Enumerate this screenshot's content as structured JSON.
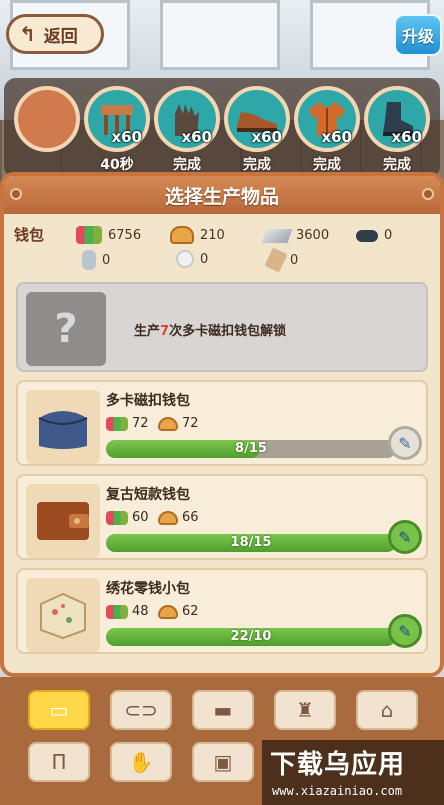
{
  "top": {
    "back_label": "返回",
    "upgrade_label": "升级"
  },
  "queue": [
    {
      "icon": "empty-slot",
      "qty": "",
      "status": ""
    },
    {
      "icon": "stool-icon",
      "qty": "x60",
      "status": "40秒"
    },
    {
      "icon": "gloves-icon",
      "qty": "x60",
      "status": "完成"
    },
    {
      "icon": "shoe-icon",
      "qty": "x60",
      "status": "完成"
    },
    {
      "icon": "jacket-icon",
      "qty": "x60",
      "status": "完成"
    },
    {
      "icon": "boot-icon",
      "qty": "x60",
      "status": "完成"
    }
  ],
  "panel": {
    "title": "选择生产物品",
    "wallet_label": "钱包"
  },
  "resources": [
    {
      "icon": "fabric-icon",
      "value": "6756"
    },
    {
      "icon": "cotton-icon",
      "value": "210"
    },
    {
      "icon": "metal-icon",
      "value": "3600"
    },
    {
      "icon": "dark-material-icon",
      "value": "0"
    },
    {
      "icon": "thread-icon",
      "value": "0"
    },
    {
      "icon": "ball-icon",
      "value": "0"
    },
    {
      "icon": "wood-icon",
      "value": "0"
    }
  ],
  "locked_item": {
    "prefix": "生产",
    "count": "7",
    "suffix": "次多卡磁扣钱包解锁",
    "thumb": "?"
  },
  "items": [
    {
      "name": "多卡磁扣钱包",
      "cost1": "72",
      "cost2": "72",
      "progress_text": "8/15",
      "progress": 0.53,
      "ready": false
    },
    {
      "name": "复古短款钱包",
      "cost1": "60",
      "cost2": "66",
      "progress_text": "18/15",
      "progress": 1.0,
      "ready": true
    },
    {
      "name": "绣花零钱小包",
      "cost1": "48",
      "cost2": "62",
      "progress_text": "22/10",
      "progress": 1.0,
      "ready": true
    }
  ],
  "categories": [
    "wallet-icon",
    "belt-icon",
    "shoe-icon",
    "jacket-icon",
    "bag-icon",
    "pants-icon",
    "glove-icon",
    "briefcase-icon"
  ],
  "watermark": {
    "main": "下载乌应用",
    "sub": "www.xiazainiao.com"
  }
}
